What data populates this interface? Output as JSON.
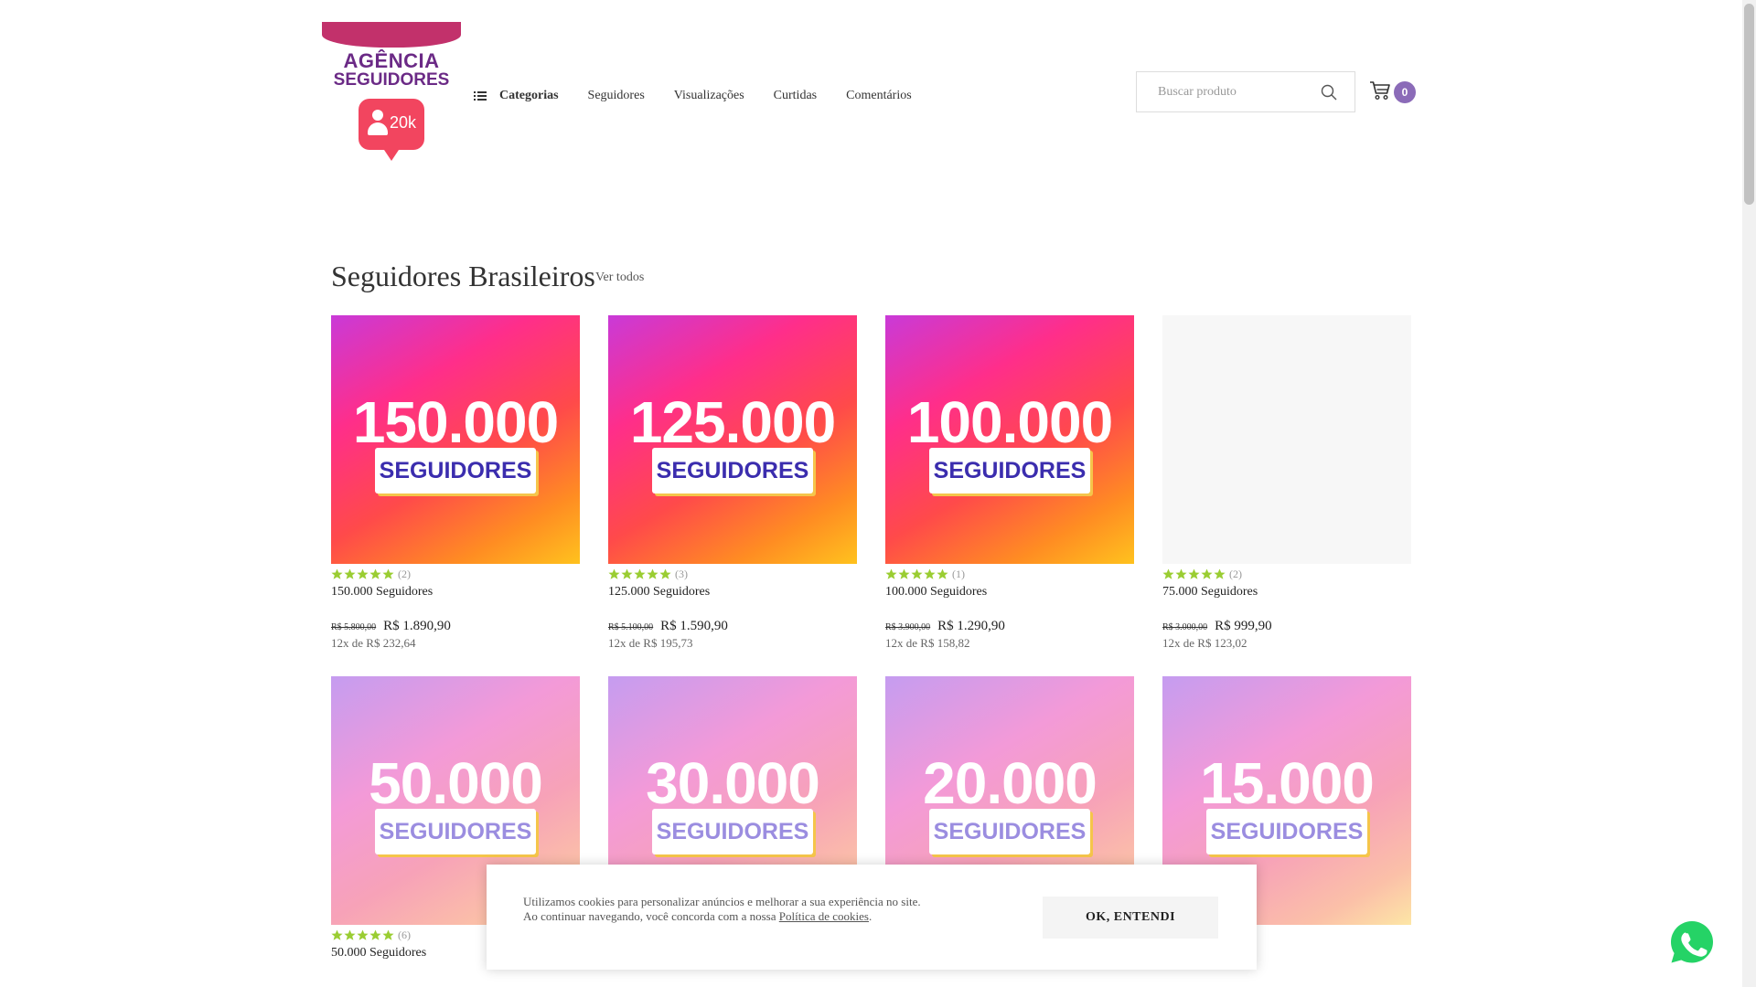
{
  "header": {
    "logo": {
      "line1": "AGÊNCIA",
      "line2": "SEGUIDORES",
      "count": "20k"
    },
    "nav": [
      {
        "label": "Categorias"
      },
      {
        "label": "Seguidores"
      },
      {
        "label": "Visualizações"
      },
      {
        "label": "Curtidas"
      },
      {
        "label": "Comentários"
      }
    ],
    "search": {
      "placeholder": "Buscar produto",
      "value": ""
    },
    "cart": {
      "count": "0"
    }
  },
  "section": {
    "title": "Seguidores Brasileiros",
    "see_all": "Ver todos"
  },
  "products": [
    {
      "thumb_number": "150.000",
      "thumb_tag": "SEGUIDORES",
      "style": "hot",
      "reviews": "(2)",
      "name": "150.000 Seguidores",
      "old_price": "R$ 5.800,00",
      "price": "R$ 1.890,90",
      "installments": "12x de R$ 232,64",
      "rating": 5
    },
    {
      "thumb_number": "125.000",
      "thumb_tag": "SEGUIDORES",
      "style": "hot",
      "reviews": "(3)",
      "name": "125.000 Seguidores",
      "old_price": "R$ 5.100,00",
      "price": "R$ 1.590,90",
      "installments": "12x de R$ 195,73",
      "rating": 5
    },
    {
      "thumb_number": "100.000",
      "thumb_tag": "SEGUIDORES",
      "style": "hot",
      "reviews": "(1)",
      "name": "100.000 Seguidores",
      "old_price": "R$ 3.900,00",
      "price": "R$ 1.290,90",
      "installments": "12x de R$ 158,82",
      "rating": 5
    },
    {
      "thumb_number": "",
      "thumb_tag": "",
      "style": "blank",
      "reviews": "(2)",
      "name": "75.000 Seguidores",
      "old_price": "R$ 3.000,00",
      "price": "R$ 999,90",
      "installments": "12x de R$ 123,02",
      "rating": 5
    },
    {
      "thumb_number": "50.000",
      "thumb_tag": "SEGUIDORES",
      "style": "soft",
      "reviews": "(6)",
      "name": "50.000 Seguidores",
      "old_price": "",
      "price": "",
      "installments": "",
      "rating": 5
    },
    {
      "thumb_number": "30.000",
      "thumb_tag": "SEGUIDORES",
      "style": "soft",
      "reviews": "",
      "name": "",
      "old_price": "",
      "price": "",
      "installments": "",
      "rating": 0
    },
    {
      "thumb_number": "20.000",
      "thumb_tag": "SEGUIDORES",
      "style": "soft",
      "reviews": "",
      "name": "",
      "old_price": "",
      "price": "",
      "installments": "",
      "rating": 0
    },
    {
      "thumb_number": "15.000",
      "thumb_tag": "SEGUIDORES",
      "style": "soft",
      "reviews": "",
      "name": "",
      "old_price": "",
      "price": "",
      "installments": "",
      "rating": 0
    }
  ],
  "cookie_banner": {
    "text": "Utilizamos cookies para personalizar anúncios e melhorar a sua experiência no site. Ao continuar navegando, você concorda com a nossa",
    "link": "Política de cookies",
    "button": "OK, ENTENDI"
  },
  "colors": {
    "cart_badge": "#8b6bb8",
    "star": "#9acd32",
    "logo_purple": "#6b2a86",
    "logo_red": "#f2455f"
  },
  "icons": [
    "list-icon",
    "search-icon",
    "cart-icon",
    "star-icon",
    "whatsapp-icon",
    "person-icon"
  ]
}
